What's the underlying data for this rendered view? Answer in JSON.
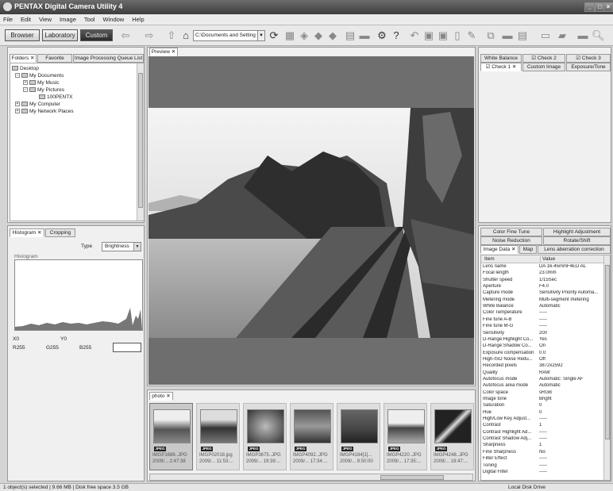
{
  "window": {
    "title": "PENTAX Digital Camera Utility 4"
  },
  "menu": [
    "File",
    "Edit",
    "View",
    "Image",
    "Tool",
    "Window",
    "Help"
  ],
  "modes": {
    "browser": "Browser",
    "laboratory": "Laboratory",
    "custom": "Custom"
  },
  "toolbar": {
    "path": "C:\\Documents and Setting"
  },
  "left_tabs": [
    "Folders",
    "Favorite",
    "Image Processing Queue List"
  ],
  "tree": [
    {
      "label": "Desktop"
    },
    {
      "label": "My Documents"
    },
    {
      "label": "My Music"
    },
    {
      "label": "My Pictures"
    },
    {
      "label": "100PENTX"
    },
    {
      "label": "My Computer"
    },
    {
      "label": "My Network Places"
    }
  ],
  "histogram": {
    "tabs": [
      "Histogram",
      "Cropping"
    ],
    "type_label": "Type",
    "type_value": "Brightness",
    "group_label": "Histogram",
    "x_label": "X0",
    "y_label": "Y0",
    "r": "R255",
    "g": "G255",
    "b": "B255"
  },
  "preview": {
    "tab": "Preview"
  },
  "photo_panel": {
    "tab": "photo"
  },
  "thumbnails": [
    {
      "name": "IMGP1688..JPG",
      "date": "2009/...  2:47:38"
    },
    {
      "name": "IMGP02018.jpg",
      "date": "2009/...  11:53:..."
    },
    {
      "name": "IMGP3675..JPG",
      "date": "2009/...  19:39:..."
    },
    {
      "name": "IMGP4092..JPG",
      "date": "2009/...  17:34:..."
    },
    {
      "name": "IMGP4184[1]...",
      "date": "2009/...  9:50:00"
    },
    {
      "name": "IMGP4220..JPG",
      "date": "2009/...  17:35:..."
    },
    {
      "name": "IMGP4248..JPG",
      "date": "2009/...  19:47:..."
    }
  ],
  "jpeg_badge": "JPEG",
  "right_tabs_top": [
    "White Balance",
    "Check 2",
    "Check 3",
    "Check 1",
    "Custom Image",
    "Exposure/Tone"
  ],
  "right_tabs_mid": [
    "Color Fine Tune",
    "Highlight Adjustment",
    "Noise Reduction",
    "Rotate/Shift",
    "Image Data",
    "Map",
    "Lens aberration correction"
  ],
  "image_data": {
    "headers": [
      "Item",
      "Value"
    ],
    "rows": [
      [
        "Lens name",
        "DA 16-45mmF4ED AL"
      ],
      [
        "Focal length",
        "23.0mm"
      ],
      [
        "Shutter speed",
        "1/15Sec"
      ],
      [
        "Aperture",
        "F4.0"
      ],
      [
        "Capture mode",
        "Sensitivity Priority Automa..."
      ],
      [
        "Metering mode",
        "Multi-segment metering"
      ],
      [
        "White Balance",
        "Automatic"
      ],
      [
        "Color Temperature",
        "-----"
      ],
      [
        "Fine tune A-B",
        "-----"
      ],
      [
        "Fine tune M-G",
        "-----"
      ],
      [
        "Sensitivity",
        "200"
      ],
      [
        "D-Range:Highlight Co...",
        "Yes"
      ],
      [
        "D-Range:Shadow Co...",
        "On"
      ],
      [
        "Exposure compensation",
        "0.0"
      ],
      [
        "High-ISO Noise Redu...",
        "Off"
      ],
      [
        "Recorded pixels",
        "3872x2592"
      ],
      [
        "Quality",
        "RAW"
      ],
      [
        "Autofocus mode",
        "Automatic: Single AF"
      ],
      [
        "Autofocus area mode",
        "Automatic"
      ],
      [
        "Color space",
        "sRGB"
      ],
      [
        "Image tone",
        "Bright"
      ],
      [
        "Saturation",
        "0"
      ],
      [
        "Hue",
        "0"
      ],
      [
        "High/Low Key Adjust...",
        "-----"
      ],
      [
        "Contrast",
        "1"
      ],
      [
        "Contrast Highlight Ad...",
        "-----"
      ],
      [
        "Contrast Shadow Adj...",
        "-----"
      ],
      [
        "Sharpness",
        "1"
      ],
      [
        "Fine Sharpness",
        "No"
      ],
      [
        "Filter Effect",
        "-----"
      ],
      [
        "Toning",
        "-----"
      ],
      [
        "Digital Filter",
        "-----"
      ]
    ]
  },
  "status": {
    "left": "1 object(s) selected | 9.66 MB | Disk free space 3.5 GB",
    "right": "Local Disk Drive"
  }
}
